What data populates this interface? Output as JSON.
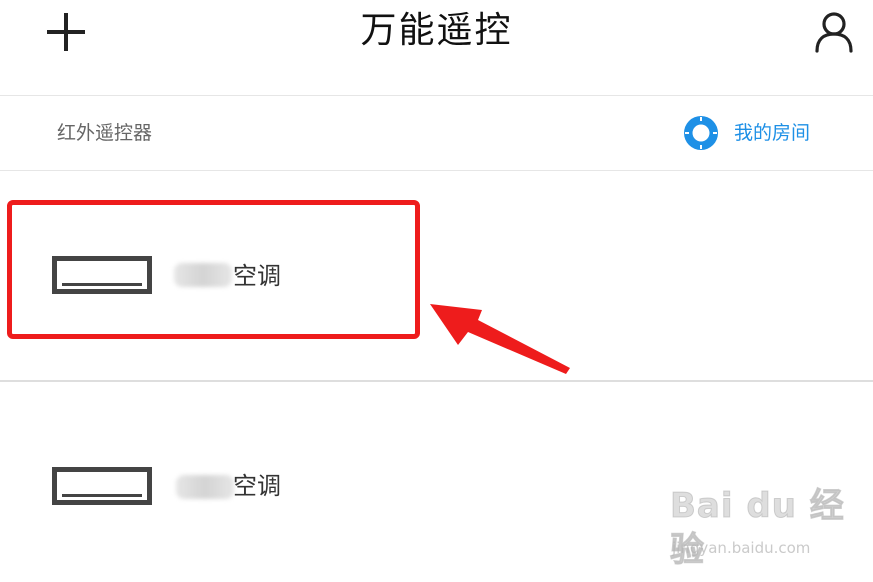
{
  "header": {
    "title": "万能遥控",
    "add_icon": "plus-icon",
    "user_icon": "user-icon"
  },
  "section": {
    "label": "红外遥控器",
    "room_link_label": "我的房间",
    "room_icon": "room-target-icon",
    "accent_color": "#1e90e6"
  },
  "devices": [
    {
      "name": "空调",
      "icon": "air-conditioner-icon",
      "highlighted": true
    },
    {
      "name": "空调",
      "icon": "air-conditioner-icon",
      "highlighted": false
    }
  ],
  "annotation": {
    "highlight_color": "#ee1c1c",
    "pointer_icon": "red-arrow-icon"
  },
  "watermark": {
    "logo": "Bai du 经验",
    "url": "jingyan.baidu.com"
  }
}
